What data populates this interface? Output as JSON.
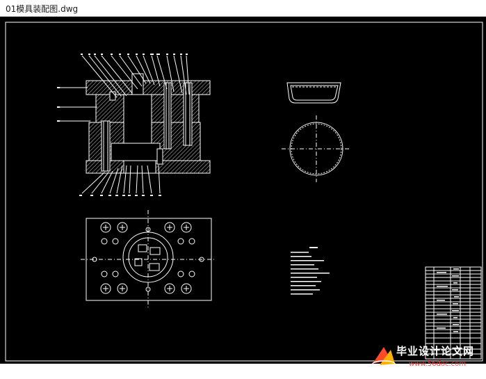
{
  "window": {
    "title": "01模具装配图.dwg"
  },
  "colors": {
    "background": "#000000",
    "line": "#ffffff",
    "hatch": "#ffffff",
    "watermark_accent": "#ff4a2a"
  },
  "watermark": {
    "text": "毕业设计论文网",
    "url": "www.56doc.com"
  },
  "drawing": {
    "views": [
      "section-view",
      "top-plan-view",
      "part-side-view",
      "part-top-view",
      "technical-notes",
      "bill-of-materials"
    ]
  }
}
